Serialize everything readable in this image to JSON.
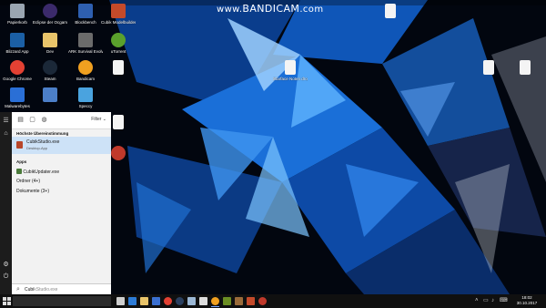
{
  "watermark": {
    "prefix": "www.",
    "brand": "BANDICAM",
    "suffix": ".com"
  },
  "desktop": {
    "icons": [
      {
        "label": "Papierkorb",
        "icon": "recycle-bin-icon",
        "color": "#9aa5b1"
      },
      {
        "label": "Eclipse der Ocgam",
        "icon": "eclipse-icon",
        "color": "#3b2a6b"
      },
      {
        "label": "Blockbench",
        "icon": "blockbench-icon",
        "color": "#2e5fb0"
      },
      {
        "label": "Cubik Modelbuilder",
        "icon": "cube-app-icon",
        "color": "#c44a2a"
      },
      {
        "label": "Blizzard App",
        "icon": "blizzard-icon",
        "color": "#1b5fa5"
      },
      {
        "label": "Dev",
        "icon": "folder-icon",
        "color": "#e9c46a"
      },
      {
        "label": "ARK Survival Evolved",
        "icon": "ark-icon",
        "color": "#6b6b6b"
      },
      {
        "label": "uTorrent",
        "icon": "utorrent-icon",
        "color": "#5aa02c"
      },
      {
        "label": "Google Chrome",
        "icon": "chrome-icon",
        "color": "#e34133"
      },
      {
        "label": "Steam",
        "icon": "steam-icon",
        "color": "#1b2838"
      },
      {
        "label": "Bandicam",
        "icon": "bandicam-icon",
        "color": "#f0a020"
      },
      {
        "label": "",
        "icon": "document-icon",
        "color": "#f4f4f4"
      },
      {
        "label": "Malwarebytes",
        "icon": "malwarebytes-icon",
        "color": "#2a6fd6"
      },
      {
        "label": "",
        "icon": "app-icon",
        "color": "#4c7fc8"
      },
      {
        "label": "Speccy",
        "icon": "speccy-icon",
        "color": "#4aa3df"
      },
      {
        "label": "",
        "icon": "document-icon",
        "color": "#f4f4f4"
      },
      {
        "label": "",
        "icon": "document-icon",
        "color": "#f4f4f4"
      },
      {
        "label": "",
        "icon": "app-icon",
        "color": "#c0392b"
      },
      {
        "label": "Starface Noten droppen",
        "icon": "document-icon",
        "color": "#f4f4f4"
      },
      {
        "label": "",
        "icon": "document-icon",
        "color": "#f4f4f4"
      },
      {
        "label": "",
        "icon": "document-icon",
        "color": "#f4f4f4"
      }
    ]
  },
  "start_menu": {
    "rail": {
      "top": [
        "hamburger-icon",
        "home-icon"
      ],
      "bottom": [
        "gear-icon",
        "power-icon"
      ]
    },
    "toolbar": {
      "tools": [
        "apps-icon",
        "documents-icon",
        "web-icon"
      ],
      "filter_label": "Filter"
    },
    "best_match_header": "Höchste Übereinstimmung",
    "best_match": {
      "title": "CubikStudio.exe",
      "subtitle": "Desktop-App",
      "icon_color": "#b8462a"
    },
    "apps_header": "Apps",
    "apps": [
      {
        "label": "CubikUpdater.exe",
        "icon_color": "#4a7a3a"
      }
    ],
    "categories": [
      "Ordner (4+)",
      "Dokumente (3+)"
    ],
    "search": {
      "typed": "Cubi",
      "suggestion": "kStudio.exe"
    }
  },
  "taskbar": {
    "pinned": [
      {
        "icon": "task-view-icon",
        "color": "#cfcfcf"
      },
      {
        "icon": "edge-icon",
        "color": "#2d7bd6"
      },
      {
        "icon": "explorer-icon",
        "color": "#e9c46a"
      },
      {
        "icon": "store-icon",
        "color": "#3a6fd0"
      },
      {
        "icon": "chrome-icon",
        "color": "#e34133"
      },
      {
        "icon": "steam-icon",
        "color": "#2a3f5f"
      },
      {
        "icon": "notepad-icon",
        "color": "#9bb7d4"
      },
      {
        "icon": "unity-icon",
        "color": "#dddddd"
      },
      {
        "icon": "bandicam-icon",
        "color": "#f0a020"
      },
      {
        "icon": "minecraft-icon",
        "color": "#6b8e23"
      },
      {
        "icon": "game-icon",
        "color": "#9a6b3a"
      },
      {
        "icon": "cubik-icon",
        "color": "#c44a2a"
      },
      {
        "icon": "app-icon",
        "color": "#c0392b"
      }
    ],
    "tray": [
      "chevron-up-icon",
      "network-icon",
      "volume-icon",
      "keyboard-icon"
    ],
    "clock": {
      "time": "18:02",
      "date": "30.10.2017"
    }
  }
}
